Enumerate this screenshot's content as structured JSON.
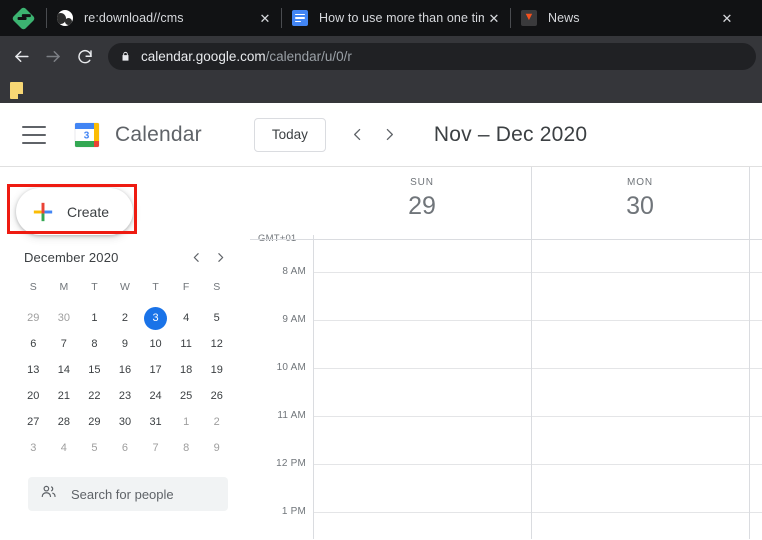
{
  "browser": {
    "brand_icon": "evernote-diamond-icon",
    "tabs": [
      {
        "favicon": "globe-icon",
        "title": "re:download//cms",
        "close_label": "✕"
      },
      {
        "favicon": "google-docs-icon",
        "title": "How to use more than one timez",
        "close_label": "✕"
      },
      {
        "favicon": "news-chevron-icon",
        "title": "News",
        "close_label": "✕"
      }
    ],
    "toolbar": {
      "back_label": "←",
      "forward_label": "→",
      "reload_label": "⟳",
      "lock_icon": "padlock-icon",
      "url_host": "calendar.google.com",
      "url_path": "/calendar/u/0/r"
    },
    "bookmarks": {
      "item_icon": "yellow-file-icon"
    }
  },
  "calendar": {
    "menu_icon": "hamburger-menu-icon",
    "logo_icon": "google-calendar-logo",
    "logo_day": "3",
    "app_title": "Calendar",
    "today_label": "Today",
    "prev_label": "‹",
    "next_label": "›",
    "range_title": "Nov – Dec 2020"
  },
  "sidebar": {
    "create_label": "Create",
    "create_icon": "google-plus-icon",
    "highlight_color": "#ee1b11",
    "mini_calendar": {
      "month": "December 2020",
      "prev_label": "‹",
      "next_label": "›",
      "dow": [
        "S",
        "M",
        "T",
        "W",
        "T",
        "F",
        "S"
      ],
      "today": "3",
      "weeks": [
        [
          {
            "d": "29",
            "muted": true
          },
          {
            "d": "30",
            "muted": true
          },
          {
            "d": "1"
          },
          {
            "d": "2"
          },
          {
            "d": "3",
            "today": true
          },
          {
            "d": "4"
          },
          {
            "d": "5"
          }
        ],
        [
          {
            "d": "6"
          },
          {
            "d": "7"
          },
          {
            "d": "8"
          },
          {
            "d": "9"
          },
          {
            "d": "10"
          },
          {
            "d": "11"
          },
          {
            "d": "12"
          }
        ],
        [
          {
            "d": "13"
          },
          {
            "d": "14"
          },
          {
            "d": "15"
          },
          {
            "d": "16"
          },
          {
            "d": "17"
          },
          {
            "d": "18"
          },
          {
            "d": "19"
          }
        ],
        [
          {
            "d": "20"
          },
          {
            "d": "21"
          },
          {
            "d": "22"
          },
          {
            "d": "23"
          },
          {
            "d": "24"
          },
          {
            "d": "25"
          },
          {
            "d": "26"
          }
        ],
        [
          {
            "d": "27"
          },
          {
            "d": "28"
          },
          {
            "d": "29"
          },
          {
            "d": "30"
          },
          {
            "d": "31"
          },
          {
            "d": "1",
            "muted": true
          },
          {
            "d": "2",
            "muted": true
          }
        ],
        [
          {
            "d": "3",
            "muted": true
          },
          {
            "d": "4",
            "muted": true
          },
          {
            "d": "5",
            "muted": true
          },
          {
            "d": "6",
            "muted": true
          },
          {
            "d": "7",
            "muted": true
          },
          {
            "d": "8",
            "muted": true
          },
          {
            "d": "9",
            "muted": true
          }
        ]
      ]
    },
    "people_search": {
      "icon": "people-icon",
      "placeholder": "Search for people"
    }
  },
  "grid": {
    "timezone_label": "GMT+01",
    "days": [
      {
        "dow": "SUN",
        "num": "29"
      },
      {
        "dow": "MON",
        "num": "30"
      }
    ],
    "hours": [
      "8 AM",
      "9 AM",
      "10 AM",
      "11 AM",
      "12 PM",
      "1 PM"
    ]
  }
}
